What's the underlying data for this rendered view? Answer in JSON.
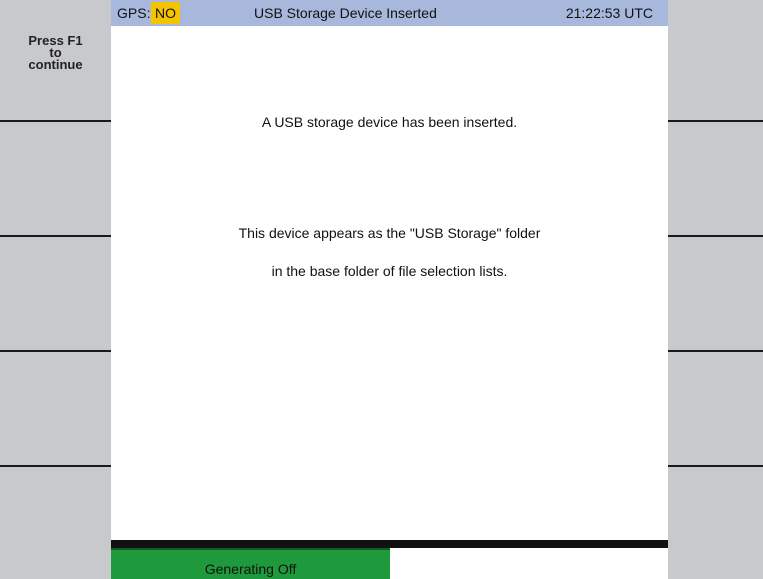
{
  "header": {
    "gps_label": "GPS:",
    "gps_value": "NO",
    "title": "USB Storage Device Inserted",
    "time": "21:22:53 UTC"
  },
  "softkeys": {
    "f1_line1": "Press F1",
    "f1_line2": "to",
    "f1_line3": "continue"
  },
  "message": {
    "line1": "A USB storage device has been inserted.",
    "line2": "This device appears as the \"USB Storage\" folder",
    "line3": "in the base folder of file selection lists."
  },
  "status": {
    "generating": "Generating Off"
  },
  "colors": {
    "header_bg": "#a8b8dc",
    "gps_warning": "#f5c400",
    "generating_bg": "#1e9a3c",
    "softkey_bg": "#c8c9cd"
  }
}
